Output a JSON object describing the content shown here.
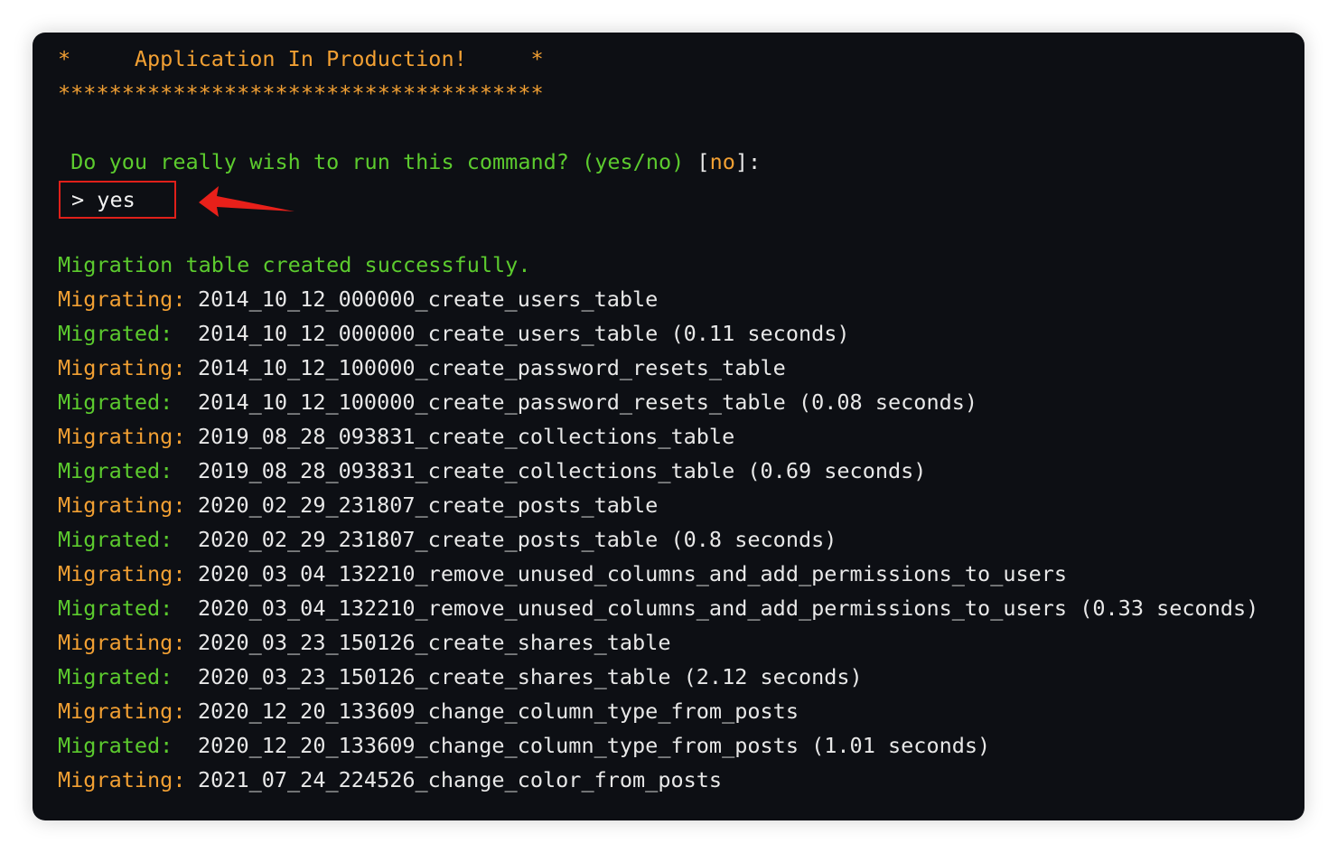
{
  "header": {
    "banner_line": "*     Application In Production!     *",
    "stars_line": "**************************************"
  },
  "prompt": {
    "question": " Do you really wish to run this command? (yes/no) ",
    "default_open": "[",
    "default_value": "no",
    "default_close": "]:",
    "answer": "> yes"
  },
  "status": {
    "created": "Migration table created successfully."
  },
  "migrations": [
    {
      "label": "Migrating:",
      "text": "2014_10_12_000000_create_users_table"
    },
    {
      "label": "Migrated:",
      "text": "2014_10_12_000000_create_users_table (0.11 seconds)"
    },
    {
      "label": "Migrating:",
      "text": "2014_10_12_100000_create_password_resets_table"
    },
    {
      "label": "Migrated:",
      "text": "2014_10_12_100000_create_password_resets_table (0.08 seconds)"
    },
    {
      "label": "Migrating:",
      "text": "2019_08_28_093831_create_collections_table"
    },
    {
      "label": "Migrated:",
      "text": "2019_08_28_093831_create_collections_table (0.69 seconds)"
    },
    {
      "label": "Migrating:",
      "text": "2020_02_29_231807_create_posts_table"
    },
    {
      "label": "Migrated:",
      "text": "2020_02_29_231807_create_posts_table (0.8 seconds)"
    },
    {
      "label": "Migrating:",
      "text": "2020_03_04_132210_remove_unused_columns_and_add_permissions_to_users"
    },
    {
      "label": "Migrated:",
      "text": "2020_03_04_132210_remove_unused_columns_and_add_permissions_to_users (0.33 seconds)"
    },
    {
      "label": "Migrating:",
      "text": "2020_03_23_150126_create_shares_table"
    },
    {
      "label": "Migrated:",
      "text": "2020_03_23_150126_create_shares_table (2.12 seconds)"
    },
    {
      "label": "Migrating:",
      "text": "2020_12_20_133609_change_column_type_from_posts"
    },
    {
      "label": "Migrated:",
      "text": "2020_12_20_133609_change_column_type_from_posts (1.01 seconds)"
    },
    {
      "label": "Migrating:",
      "text": "2021_07_24_224526_change_color_from_posts"
    }
  ],
  "colors": {
    "terminal_bg": "#0d0f14",
    "warning_orange": "#f2a033",
    "success_green": "#5ccb2e",
    "annotation_red": "#e0201a"
  },
  "annotation": {
    "icon": "red-arrow-pointer-icon"
  }
}
